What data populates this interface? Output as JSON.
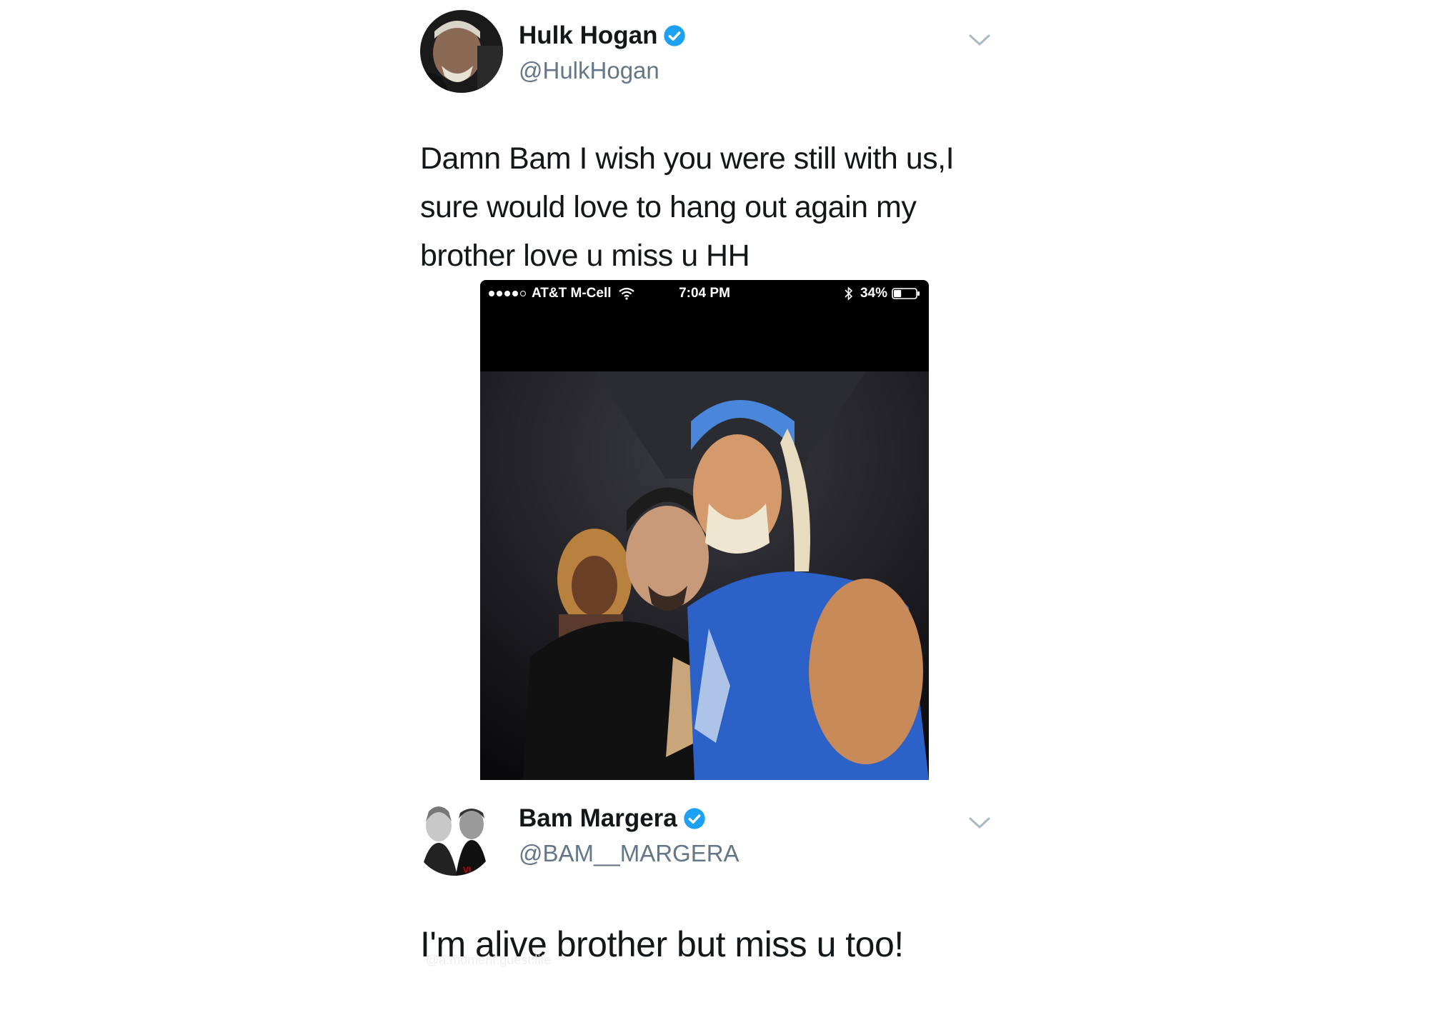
{
  "tweets": [
    {
      "name": "Hulk Hogan",
      "handle": "@HulkHogan",
      "verified": true,
      "text": "Damn  Bam I wish you were still with us,I sure would love to hang out again my brother love u miss u HH"
    },
    {
      "name": "Bam Margera",
      "handle": "@BAM__MARGERA",
      "verified": true,
      "text": "I'm alive brother but miss u too!"
    }
  ],
  "phone_screenshot": {
    "carrier": "AT&T M-Cell",
    "time": "7:04 PM",
    "battery": "34%",
    "battery_level": 0.34,
    "icons": [
      "signal-dots-icon",
      "wifi-icon",
      "bluetooth-icon",
      "battery-icon"
    ]
  },
  "watermark": "@a.moment.guest.life",
  "colors": {
    "verified_blue": "#1da1f2",
    "handle_gray": "#657786",
    "text": "#14171a",
    "chevron": "#aab8c2"
  }
}
